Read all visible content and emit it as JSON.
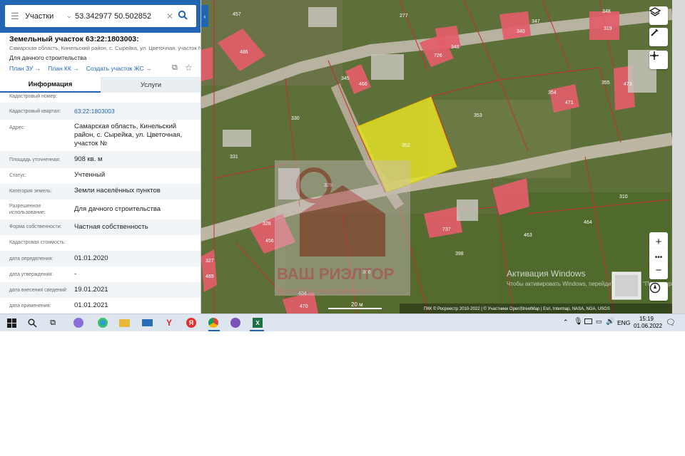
{
  "search": {
    "menu_icon": "hamburger-icon",
    "category": "Участки",
    "query": "53.342977 50.502852"
  },
  "parcel": {
    "title": "Земельный участок 63:22:1803003:",
    "address_line": "Самарская область, Кинельский район, с. Сырейка, ул. Цветочная, участок №",
    "purpose": "Для дачного строительства",
    "links": [
      "План ЗУ →",
      "План КК →",
      "Создать участок ЖС →"
    ]
  },
  "tabs": [
    "Информация",
    "Услуги"
  ],
  "fields": [
    {
      "key": "Кадастровый номер:",
      "value": ""
    },
    {
      "key": "Кадастровый квартал:",
      "value": "63:22:1803003"
    },
    {
      "key": "Адрес:",
      "value": "Самарская область, Кинельский район, с. Сырейка, ул. Цветочная, участок №"
    },
    {
      "key": "Площадь уточненная:",
      "value": "908 кв. м"
    },
    {
      "key": "Статус:",
      "value": "Учтенный"
    },
    {
      "key": "Категория земель:",
      "value": "Земли населённых пунктов"
    },
    {
      "key": "Разрешенное использование:",
      "value": "Для дачного строительства"
    },
    {
      "key": "Форма собственности:",
      "value": "Частная собственность"
    },
    {
      "key": "Кадастровая стоимость:",
      "value": ""
    },
    {
      "key": "дата определения:",
      "value": "01.01.2020"
    },
    {
      "key": "дата утверждения:",
      "value": "-"
    },
    {
      "key": "дата внесения сведений:",
      "value": "19.01.2021"
    },
    {
      "key": "дата применения:",
      "value": "01.01.2021"
    }
  ],
  "map": {
    "plot_numbers": [
      "457",
      "277",
      "348",
      "319",
      "340",
      "347",
      "486",
      "346",
      "726",
      "345",
      "466",
      "355",
      "354",
      "471",
      "473",
      "330",
      "353",
      "352",
      "331",
      "329",
      "310",
      "328",
      "456",
      "737",
      "464",
      "463",
      "398",
      "327",
      "489",
      "306",
      "404",
      "470"
    ],
    "highlight_color": "#e3e024",
    "building_color": "#e35d6a",
    "scale_label": "20 м",
    "attribution": "ПКК © Росреестр 2010-2022 | © Участники OpenStreetMap | Esri, Intermap, NASA, NGA, USGS",
    "watermark_line1": "ВАШ РИЭЛТОР",
    "watermark_line2": "агентство недвижимости",
    "activation_title": "Активация Windows",
    "activation_sub": "Чтобы активировать Windows, перейдите в раздел \"Параметры\"."
  },
  "taskbar": {
    "lang": "ENG",
    "time": "15:19",
    "date": "01.06.2022"
  }
}
